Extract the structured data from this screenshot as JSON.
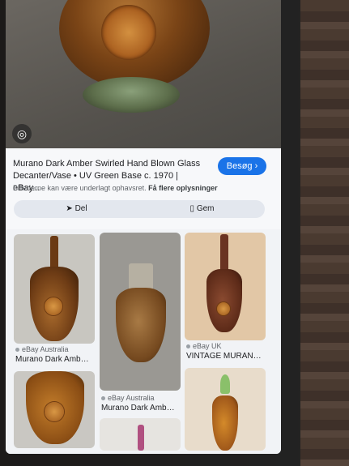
{
  "result": {
    "title": "Murano Dark Amber Swirled Hand Blown Glass Decanter/Vase • UV Green Base c. 1970 | eBay...",
    "visit_label": "Besøg",
    "copyright_text": "Billederne kan være underlagt ophavsret.",
    "copyright_link": "Få flere oplysninger",
    "share_label": "Del",
    "save_label": "Gem"
  },
  "icons": {
    "lens": "lens-icon",
    "share": "share-icon",
    "bookmark": "bookmark-icon",
    "chevron": "chevron-right-icon"
  },
  "colors": {
    "accent": "#1a73e8",
    "screen_bg": "#f1f3f6"
  },
  "related": [
    {
      "source": "eBay Australia",
      "caption": "Murano Dark Amb…"
    },
    {
      "source": "eBay Australia",
      "caption": "Murano Dark Amb…"
    },
    {
      "source": "eBay UK",
      "caption": "VINTAGE MURAN…"
    }
  ]
}
